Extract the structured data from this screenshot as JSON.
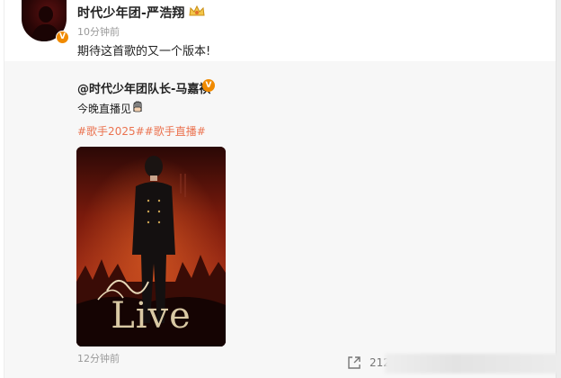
{
  "post": {
    "username": "时代少年团-严浩翔",
    "time": "10分钟前",
    "text": "期待这首歌的又一个版本!",
    "verified_mark": "V"
  },
  "repost": {
    "username": "@时代少年团队长-马嘉祺",
    "verified_mark": "V",
    "text": "今晚直播见",
    "hashtags": "#歌手2025##歌手直播#",
    "time": "12分钟前",
    "poster_text": "Live"
  },
  "actions": {
    "share_count": "212"
  },
  "colors": {
    "hashtag": "#eb7350",
    "verified": "#f08a00",
    "muted": "#9a9a9a"
  }
}
